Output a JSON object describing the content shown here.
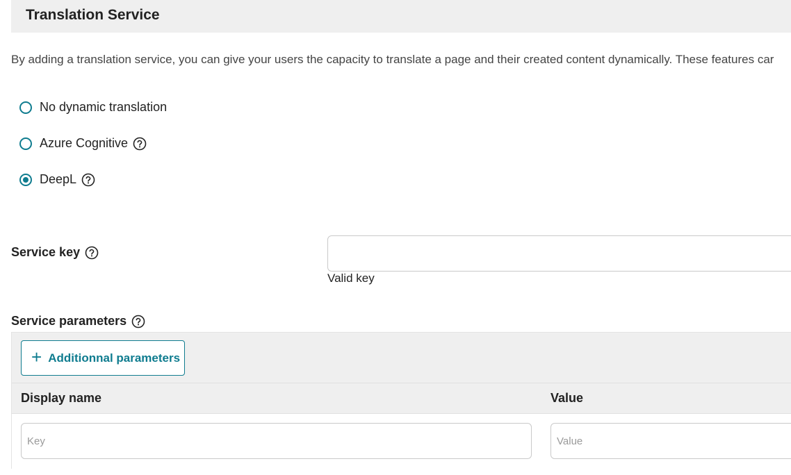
{
  "section": {
    "title": "Translation Service",
    "description": "By adding a translation service, you can give your users the capacity to translate a page and their created content dynamically. These features car"
  },
  "translation_options": [
    {
      "label": "No dynamic translation",
      "selected": false,
      "has_help": false
    },
    {
      "label": "Azure Cognitive",
      "selected": false,
      "has_help": true
    },
    {
      "label": "DeepL",
      "selected": true,
      "has_help": true
    }
  ],
  "service_key": {
    "label": "Service key",
    "value": "",
    "status": "Valid key"
  },
  "service_parameters": {
    "label": "Service parameters",
    "add_button_label": "Additionnal parameters",
    "add_button_icon": "plus-icon",
    "columns": [
      "Display name",
      "Value"
    ],
    "row": {
      "key_placeholder": "Key",
      "value_placeholder": "Value"
    }
  },
  "colors": {
    "accent": "#0f7c8f",
    "header_bg": "#efefef"
  },
  "icons": {
    "help": "help-icon"
  }
}
